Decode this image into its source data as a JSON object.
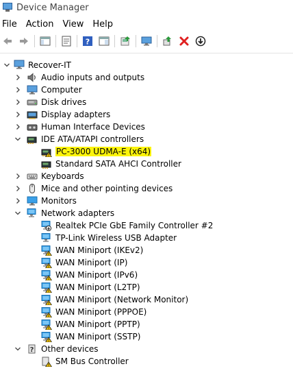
{
  "window": {
    "title": "Device Manager"
  },
  "menu": [
    "File",
    "Action",
    "View",
    "Help"
  ],
  "toolbar": {
    "icons": [
      "back-arrow-icon",
      "forward-arrow-icon",
      "show-hide-console-tree-icon",
      "properties-icon",
      "help-icon",
      "show-hide-action-pane-icon",
      "update-driver-icon",
      "scan-hardware-icon",
      "enable-device-icon",
      "uninstall-device-icon",
      "disable-device-icon"
    ]
  },
  "tree": {
    "root": "Recover-IT",
    "items": [
      {
        "label": "Audio inputs and outputs",
        "level": 1,
        "expanded": false,
        "icon": "speaker-icon"
      },
      {
        "label": "Computer",
        "level": 1,
        "expanded": false,
        "icon": "computer-icon"
      },
      {
        "label": "Disk drives",
        "level": 1,
        "expanded": false,
        "icon": "disk-drive-icon"
      },
      {
        "label": "Display adapters",
        "level": 1,
        "expanded": false,
        "icon": "display-adapter-icon"
      },
      {
        "label": "Human Interface Devices",
        "level": 1,
        "expanded": false,
        "icon": "hid-icon"
      },
      {
        "label": "IDE ATA/ATAPI controllers",
        "level": 1,
        "expanded": true,
        "icon": "ide-controller-icon"
      },
      {
        "label": "PC-3000 UDMA-E (x64)",
        "level": 2,
        "icon": "ide-controller-warning-icon",
        "highlighted": true
      },
      {
        "label": "Standard SATA AHCI Controller",
        "level": 2,
        "icon": "ide-controller-icon"
      },
      {
        "label": "Keyboards",
        "level": 1,
        "expanded": false,
        "icon": "keyboard-icon"
      },
      {
        "label": "Mice and other pointing devices",
        "level": 1,
        "expanded": false,
        "icon": "mouse-icon"
      },
      {
        "label": "Monitors",
        "level": 1,
        "expanded": false,
        "icon": "monitor-icon"
      },
      {
        "label": "Network adapters",
        "level": 1,
        "expanded": true,
        "icon": "network-adapter-icon"
      },
      {
        "label": "Realtek PCIe GbE Family Controller #2",
        "level": 2,
        "icon": "network-adapter-disabled-icon"
      },
      {
        "label": "TP-Link Wireless USB Adapter",
        "level": 2,
        "icon": "network-adapter-icon"
      },
      {
        "label": "WAN Miniport (IKEv2)",
        "level": 2,
        "icon": "network-adapter-warning-icon"
      },
      {
        "label": "WAN Miniport (IP)",
        "level": 2,
        "icon": "network-adapter-warning-icon"
      },
      {
        "label": "WAN Miniport (IPv6)",
        "level": 2,
        "icon": "network-adapter-warning-icon"
      },
      {
        "label": "WAN Miniport (L2TP)",
        "level": 2,
        "icon": "network-adapter-warning-icon"
      },
      {
        "label": "WAN Miniport (Network Monitor)",
        "level": 2,
        "icon": "network-adapter-warning-icon"
      },
      {
        "label": "WAN Miniport (PPPOE)",
        "level": 2,
        "icon": "network-adapter-warning-icon"
      },
      {
        "label": "WAN Miniport (PPTP)",
        "level": 2,
        "icon": "network-adapter-warning-icon"
      },
      {
        "label": "WAN Miniport (SSTP)",
        "level": 2,
        "icon": "network-adapter-warning-icon"
      },
      {
        "label": "Other devices",
        "level": 1,
        "expanded": true,
        "icon": "unknown-device-icon"
      },
      {
        "label": "SM Bus Controller",
        "level": 2,
        "icon": "unknown-device-warning-icon"
      }
    ]
  },
  "colors": {
    "highlight": "#fcf40c",
    "warning": "#f2c200",
    "network": "#3aa0e8",
    "uninstall": "#e02020"
  }
}
